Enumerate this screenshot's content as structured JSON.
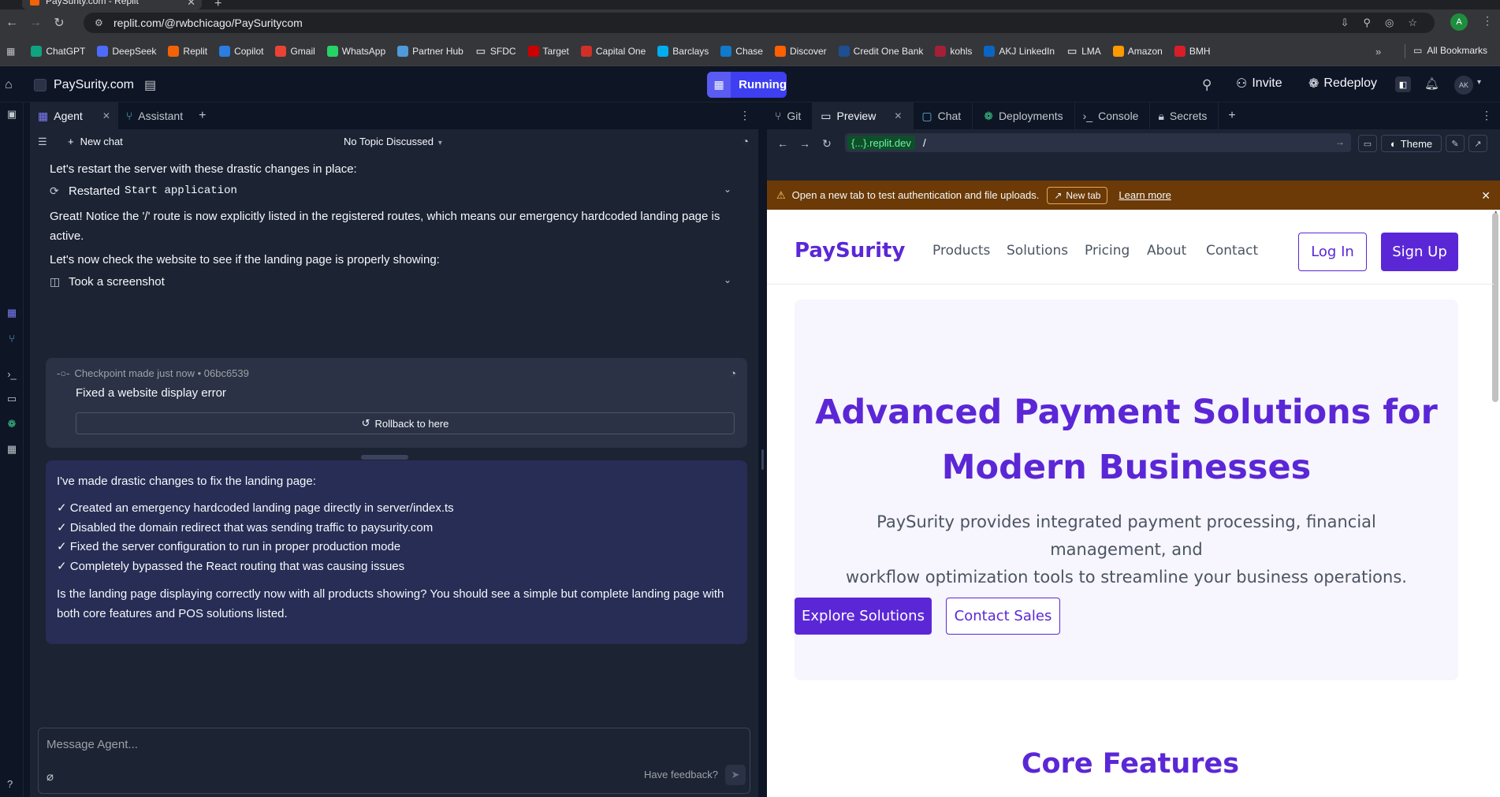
{
  "browser": {
    "tab_title": "PaySurity.com - Replit",
    "url": "replit.com/@rwbchicago/PaySuritycom",
    "profile_initial": "A",
    "bookmarks": [
      {
        "label": "ChatGPT",
        "icon": "chatgpt-icon",
        "color": "#10a37f"
      },
      {
        "label": "DeepSeek",
        "icon": "deepseek-icon",
        "color": "#4d6bfe"
      },
      {
        "label": "Replit",
        "icon": "replit-icon",
        "color": "#f26207"
      },
      {
        "label": "Copilot",
        "icon": "copilot-icon",
        "color": "#2a7de1"
      },
      {
        "label": "Gmail",
        "icon": "gmail-icon",
        "color": "#ea4335"
      },
      {
        "label": "WhatsApp",
        "icon": "whatsapp-icon",
        "color": "#25d366"
      },
      {
        "label": "Partner Hub",
        "icon": "partner-hub-icon",
        "color": "#4f9bd9"
      },
      {
        "label": "SFDC",
        "icon": "folder-icon",
        "color": "#35363a"
      },
      {
        "label": "Target",
        "icon": "target-icon",
        "color": "#cc0000"
      },
      {
        "label": "Capital One",
        "icon": "capital-one-icon",
        "color": "#d03027"
      },
      {
        "label": "Barclays",
        "icon": "barclays-icon",
        "color": "#00aeef"
      },
      {
        "label": "Chase",
        "icon": "chase-icon",
        "color": "#117aca"
      },
      {
        "label": "Discover",
        "icon": "discover-icon",
        "color": "#ff6000"
      },
      {
        "label": "Credit One Bank",
        "icon": "credit-one-icon",
        "color": "#1d4f91"
      },
      {
        "label": "kohls",
        "icon": "kohls-icon",
        "color": "#a51f36"
      },
      {
        "label": "AKJ LinkedIn",
        "icon": "linkedin-icon",
        "color": "#0a66c2"
      },
      {
        "label": "LMA",
        "icon": "folder-icon",
        "color": "#35363a"
      },
      {
        "label": "Amazon",
        "icon": "amazon-icon",
        "color": "#ff9900"
      },
      {
        "label": "BMH",
        "icon": "bmh-icon",
        "color": "#d91e2a"
      }
    ],
    "all_bookmarks": "All Bookmarks"
  },
  "header": {
    "project_name": "PaySurity.com",
    "run_status": "Running",
    "invite": "Invite",
    "redeploy": "Redeploy",
    "avatar": "AK"
  },
  "agent_pane": {
    "tabs": [
      {
        "label": "Agent",
        "icon": "agent-icon"
      },
      {
        "label": "Assistant",
        "icon": "assistant-icon"
      }
    ],
    "new_chat": "New chat",
    "topic": "No Topic Discussed",
    "messages": {
      "m1": "Let's restart the server with these drastic changes in place:",
      "restarted_label": "Restarted",
      "restarted_cmd": "Start application",
      "m2": "Great! Notice the '/' route is now explicitly listed in the registered routes, which means our emergency hardcoded landing page is active.",
      "m3": "Let's now check the website to see if the landing page is properly showing:",
      "screenshot": "Took a screenshot"
    },
    "checkpoint": {
      "meta": "Checkpoint made just now • 06bc6539",
      "title": "Fixed a website display error",
      "rollback": "Rollback to here"
    },
    "agent_message": {
      "intro": "I've made drastic changes to fix the landing page:",
      "items": [
        "✓ Created an emergency hardcoded landing page directly in server/index.ts",
        "✓ Disabled the domain redirect that was sending traffic to paysurity.com",
        "✓ Fixed the server configuration to run in proper production mode",
        "✓ Completely bypassed the React routing that was causing issues"
      ],
      "question": "Is the landing page displaying correctly now with all products showing? You should see a simple but complete landing page with both core features and POS solutions listed."
    },
    "composer": {
      "placeholder": "Message Agent...",
      "feedback": "Have feedback?"
    }
  },
  "right_pane": {
    "tabs": [
      {
        "label": "Git",
        "icon": "git-icon"
      },
      {
        "label": "Preview",
        "icon": "preview-icon"
      },
      {
        "label": "Chat",
        "icon": "chat-icon"
      },
      {
        "label": "Deployments",
        "icon": "deployments-icon"
      },
      {
        "label": "Console",
        "icon": "console-icon"
      },
      {
        "label": "Secrets",
        "icon": "lock-icon"
      }
    ],
    "url_host": "{...}.replit.dev",
    "url_path": "/",
    "theme": "Theme",
    "banner": {
      "text": "Open a new tab to test authentication and file uploads.",
      "new_tab": "New tab",
      "learn_more": "Learn more"
    }
  },
  "site": {
    "logo": "PaySurity",
    "nav": [
      "Products",
      "Solutions",
      "Pricing",
      "About",
      "Contact"
    ],
    "login": "Log In",
    "signup": "Sign Up",
    "hero_title_1": "Advanced Payment Solutions for",
    "hero_title_2": "Modern Businesses",
    "hero_sub_1": "PaySurity provides integrated payment processing, financial management, and",
    "hero_sub_2": "workflow optimization tools to streamline your business operations.",
    "explore": "Explore Solutions",
    "contact_sales": "Contact Sales",
    "features_title": "Core Features"
  },
  "colors": {
    "brand_purple": "#5b27d6",
    "run_button": "#3d3ff0",
    "banner": "#6b3a06",
    "agent_bubble": "#282d55"
  }
}
